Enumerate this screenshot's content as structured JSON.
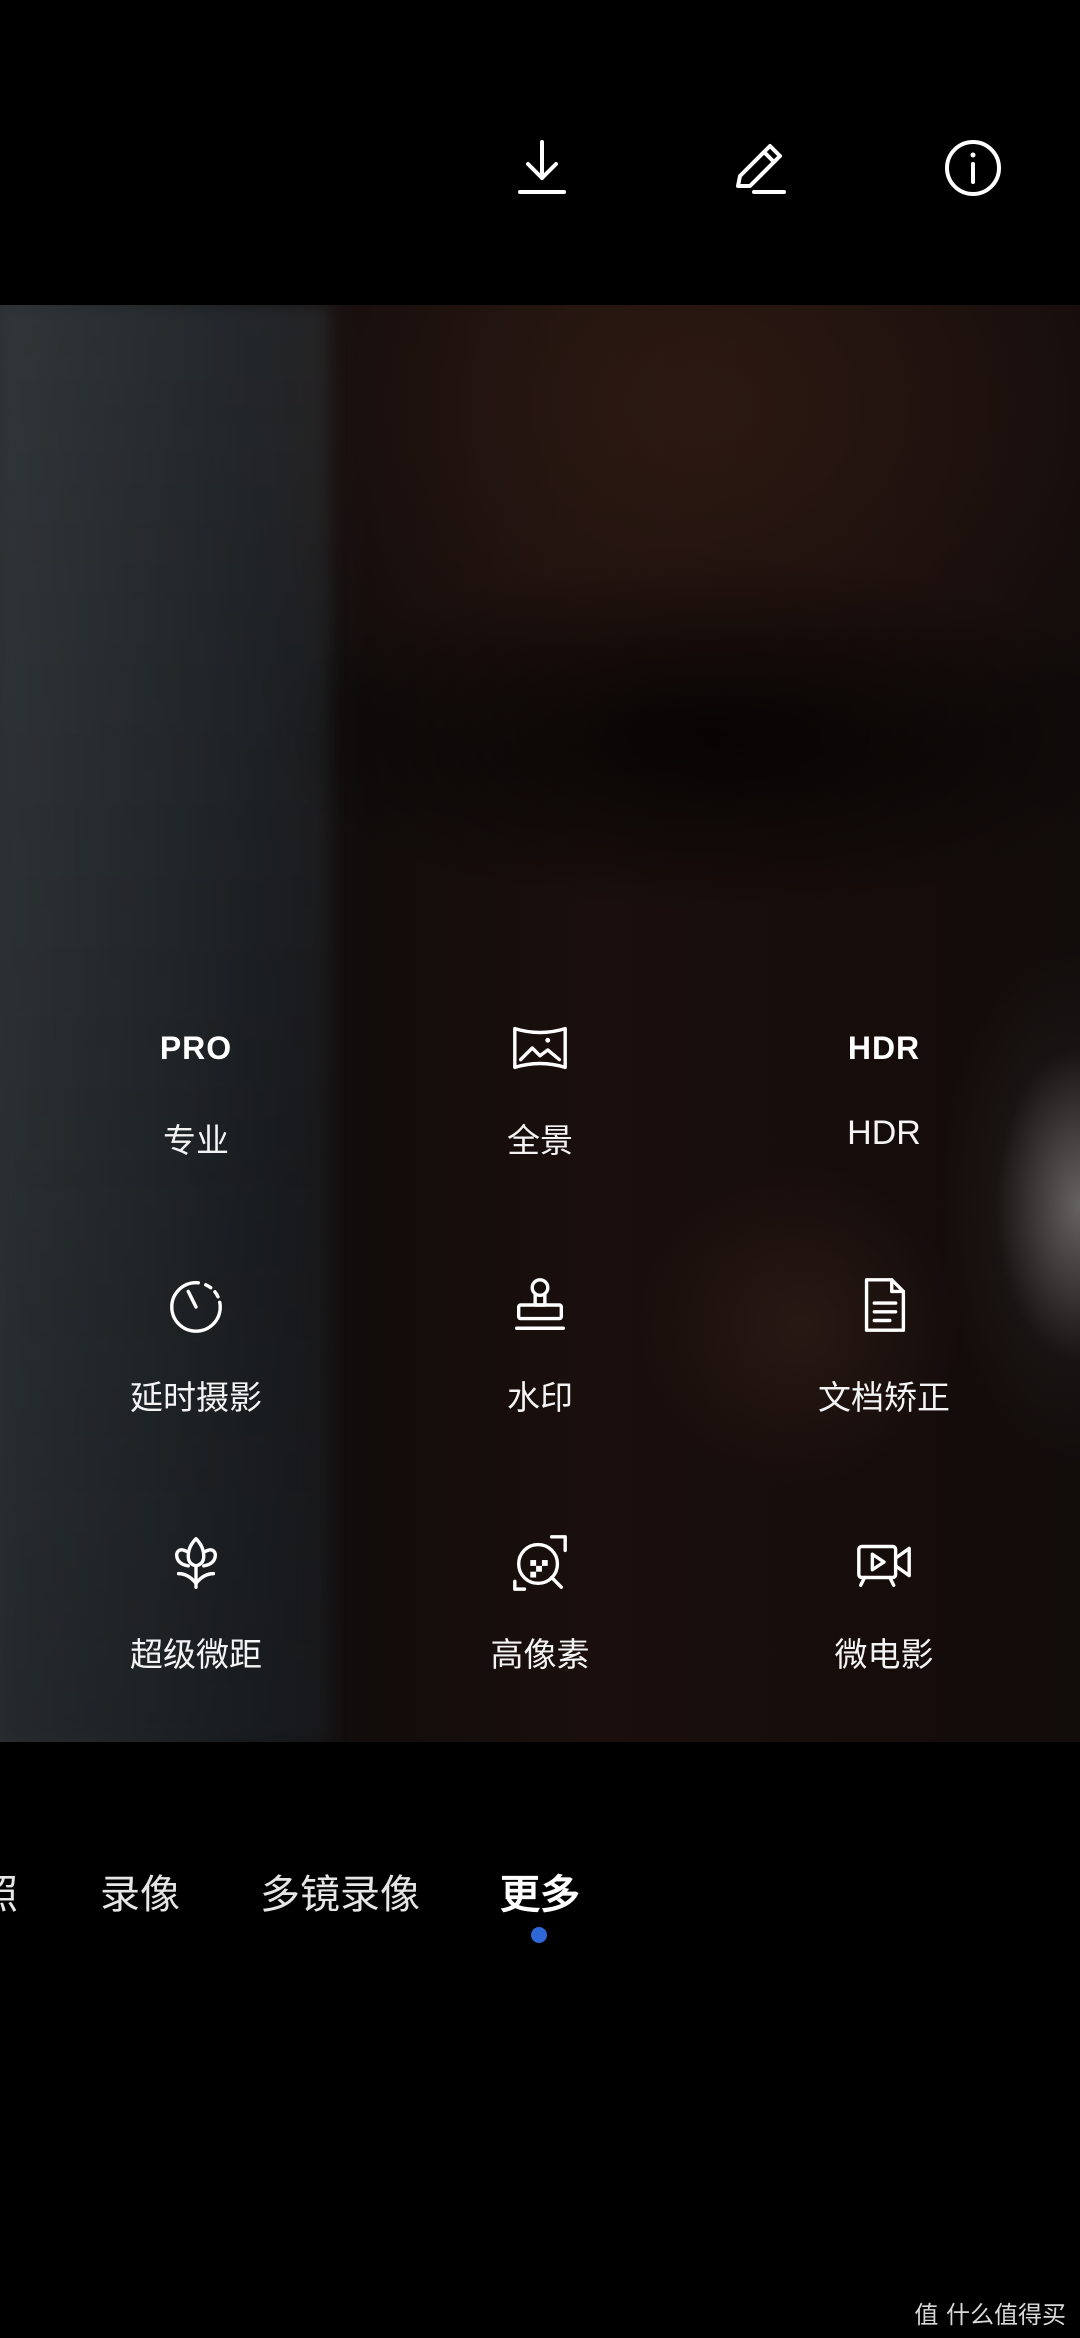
{
  "top_actions": {
    "download_icon": "download-icon",
    "edit_icon": "edit-pen-icon",
    "info_icon": "info-icon"
  },
  "modes": [
    {
      "icon_text": "PRO",
      "label": "专业"
    },
    {
      "icon": "panorama-icon",
      "label": "全景"
    },
    {
      "icon_text": "HDR",
      "label": "HDR"
    },
    {
      "icon": "timelapse-icon",
      "label": "延时摄影"
    },
    {
      "icon": "watermark-stamp-icon",
      "label": "水印"
    },
    {
      "icon": "document-icon",
      "label": "文档矫正"
    },
    {
      "icon": "macro-flower-icon",
      "label": "超级微距"
    },
    {
      "icon": "high-resolution-icon",
      "label": "高像素"
    },
    {
      "icon": "micro-movie-icon",
      "label": "微电影"
    }
  ],
  "tabs": {
    "photo": "照",
    "video": "录像",
    "multi_video": "多镜录像",
    "more": "更多",
    "active": "更多",
    "indicator_color": "#2f67d8"
  },
  "watermark": "值 什么值得买"
}
